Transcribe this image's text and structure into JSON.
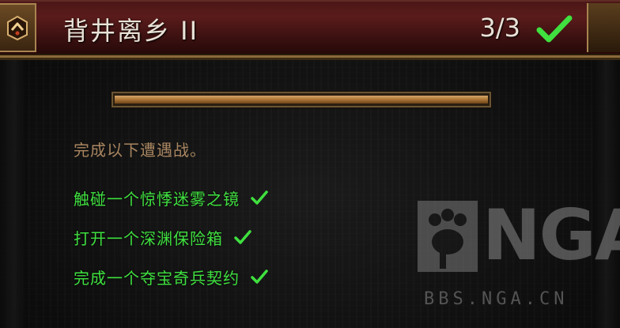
{
  "quest": {
    "title": "背井离乡 II",
    "progress_text": "3/3",
    "progress_fraction": 1.0,
    "completed": true,
    "icon": "quest-emblem-icon"
  },
  "instruction": "完成以下遭遇战。",
  "tasks": [
    {
      "label": "触碰一个惊悸迷雾之镜",
      "completed": true
    },
    {
      "label": "打开一个深渊保险箱",
      "completed": true
    },
    {
      "label": "完成一个夺宝奇兵契约",
      "completed": true
    }
  ],
  "watermark": {
    "logo_text": "NGA",
    "url": "BBS.NGA.CN"
  },
  "colors": {
    "header_bg": "#4a1616",
    "title_text": "#e8e2d6",
    "instruction_text": "#a88560",
    "task_text": "#3fe03f",
    "check": "#3fe03f",
    "progress_fill": "#c08a4a"
  }
}
